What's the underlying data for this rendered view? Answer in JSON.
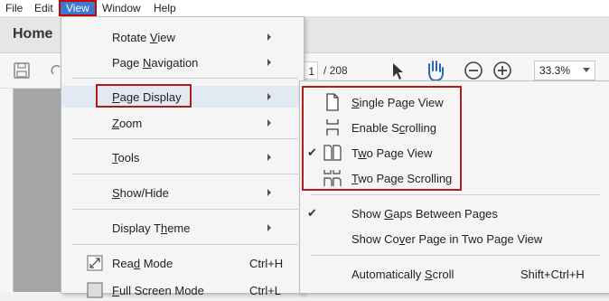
{
  "menubar": {
    "items": [
      {
        "label": "File"
      },
      {
        "label": "Edit"
      },
      {
        "label": "View"
      },
      {
        "label": "Window"
      },
      {
        "label": "Help"
      }
    ]
  },
  "tabs": {
    "home": "Home"
  },
  "toolbar": {
    "page_current": "1",
    "page_total": "/ 208",
    "zoom": "33.3%"
  },
  "view_menu": {
    "items": [
      {
        "label_pre": "Rotate ",
        "label_ul": "V",
        "label_post": "iew"
      },
      {
        "label_pre": "Page ",
        "label_ul": "N",
        "label_post": "avigation"
      },
      {
        "label_pre": "",
        "label_ul": "P",
        "label_post": "age Display"
      },
      {
        "label_pre": "",
        "label_ul": "Z",
        "label_post": "oom"
      },
      {
        "label_pre": "",
        "label_ul": "T",
        "label_post": "ools"
      },
      {
        "label_pre": "",
        "label_ul": "S",
        "label_post": "how/Hide"
      },
      {
        "label_pre": "Display T",
        "label_ul": "h",
        "label_post": "eme"
      },
      {
        "label_pre": "Rea",
        "label_ul": "d",
        "label_post": " Mode",
        "shortcut": "Ctrl+H"
      },
      {
        "label_pre": "",
        "label_ul": "F",
        "label_post": "ull Screen Mode",
        "shortcut": "Ctrl+L"
      }
    ]
  },
  "submenu": {
    "items": [
      {
        "label_pre": "",
        "label_ul": "S",
        "label_post": "ingle Page View"
      },
      {
        "label_pre": "Enable S",
        "label_ul": "c",
        "label_post": "rolling"
      },
      {
        "label_pre": "T",
        "label_ul": "w",
        "label_post": "o Page View",
        "checked": true
      },
      {
        "label_pre": "",
        "label_ul": "T",
        "label_post": "wo Page Scrolling"
      },
      {
        "label_pre": "Show ",
        "label_ul": "G",
        "label_post": "aps Between Pages",
        "checked": true
      },
      {
        "label_pre": "Show Co",
        "label_ul": "v",
        "label_post": "er Page in Two Page View"
      },
      {
        "label_pre": "Automatically ",
        "label_ul": "S",
        "label_post": "croll",
        "shortcut": "Shift+Ctrl+H"
      }
    ],
    "check_glyph": "✔"
  },
  "colors": {
    "highlight_box": "#b01c1c",
    "menu_active": "#3a79cf"
  }
}
